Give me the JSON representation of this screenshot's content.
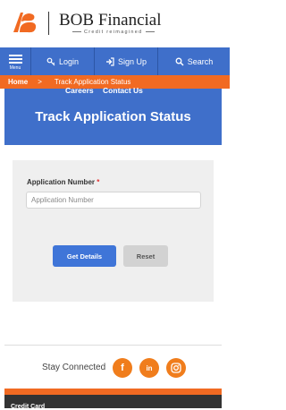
{
  "header": {
    "brand_name": "BOB Financial",
    "tagline": "Credit reimagined",
    "logo_icon": "bob-logo-icon"
  },
  "nav": {
    "menu_label": "Menu",
    "login_label": "Login",
    "signup_label": "Sign Up",
    "search_label": "Search"
  },
  "breadcrumb": {
    "home": "Home",
    "separator": ">",
    "current": "Track Application Status"
  },
  "hero": {
    "link_careers": "Careers",
    "link_contact": "Contact Us",
    "title": "Track Application Status"
  },
  "form": {
    "label": "Application Number",
    "required_mark": "*",
    "placeholder": "Application Number",
    "value": "",
    "get_details": "Get Details",
    "reset": "Reset"
  },
  "footer": {
    "stay_connected": "Stay Connected",
    "facebook": "f",
    "linkedin": "in",
    "credit_card": "Credit Card"
  },
  "colors": {
    "nav_blue": "#3f6fca",
    "accent_orange": "#f16a22",
    "button_blue": "#3f75d8"
  }
}
